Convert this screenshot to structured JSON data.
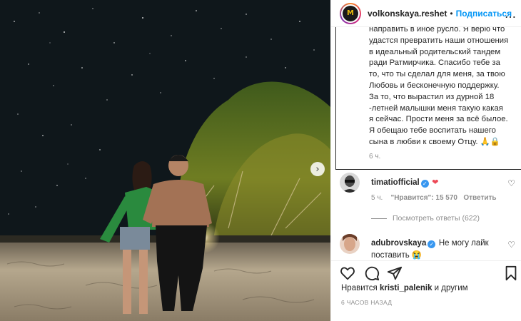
{
  "post": {
    "username": "volkonskaya.reshet",
    "separator": "•",
    "follow_label": "Подписаться",
    "more_icon": "…",
    "caption_lines": [
      "направить в иное русло. Я верю что",
      "удастся превратить наши отношения",
      "в идеальный родительский тандем",
      "ради Ратмирчика. Спасибо тебе за",
      "то, что ты сделал для меня, за твою",
      "Любовь и бесконечную поддержку.",
      "За то, что вырастил из дурной 18",
      "-летней малышки меня такую какая",
      "я сейчас. Прости меня за всё былое.",
      "Я обещаю тебе воспитать нашего",
      "сына в любви к своему Отцу. 🙏🔒"
    ],
    "caption_time": "6 ч.",
    "likes_prefix": "Нравится",
    "likes_user": "kristi_palenik",
    "likes_suffix": "и другим",
    "posted_ago": "6 ЧАСОВ НАЗАД"
  },
  "comments": [
    {
      "user": "timatiofficial",
      "text": "❤",
      "time": "5 ч.",
      "likes_label": "\"Нравится\": 15 570",
      "reply_label": "Ответить",
      "view_replies": "Посмотреть ответы (622)"
    },
    {
      "user": "adubrovskaya",
      "text_line1": "Не могу лайк",
      "text_line2": "поставить 😭"
    }
  ],
  "colors": {
    "accent": "#0095f6",
    "verified": "#3897f0",
    "heart": "#ed4956",
    "muted": "#8e8e8e"
  },
  "icons": {
    "next_arrow": "›",
    "heart_outline": "♡",
    "crown_letter": "M"
  }
}
